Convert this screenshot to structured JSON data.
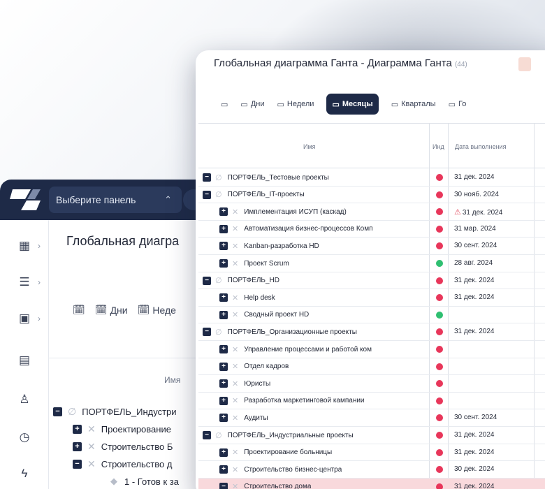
{
  "back_window": {
    "panel_select": "Выберите панель",
    "title": "Глобальная диагра",
    "tabs": [
      "Дни",
      "Неде"
    ],
    "column_name": "Имя",
    "rows": [
      {
        "label": "ПОРТФЕЛЬ_Индустри",
        "level": 0
      },
      {
        "label": "Проектирование",
        "level": 1
      },
      {
        "label": "Строительство Б",
        "level": 1
      },
      {
        "label": "Строительство д",
        "level": 1
      },
      {
        "label": "1 - Готов к за",
        "level": 2
      }
    ]
  },
  "front_window": {
    "title": "Глобальная диаграмма Ганта - Диаграмма Ганта",
    "count": "(44)",
    "tabs": [
      {
        "label": "",
        "icon": "calendar-icon"
      },
      {
        "label": "Дни",
        "icon": "calendar-icon"
      },
      {
        "label": "Недели",
        "icon": "calendar-icon"
      },
      {
        "label": "Месяцы",
        "icon": "calendar-icon",
        "active": true
      },
      {
        "label": "Кварталы",
        "icon": "calendar-icon"
      },
      {
        "label": "Го",
        "icon": "calendar-icon"
      }
    ],
    "columns": {
      "name": "Имя",
      "indicator": "Инд",
      "date": "Дата выполнения"
    },
    "rows": [
      {
        "name": "ПОРТФЕЛЬ_Тестовые проекты",
        "level": 0,
        "status": "red",
        "date": "31 дек. 2024"
      },
      {
        "name": "ПОРТФЕЛЬ_IT-проекты",
        "level": 0,
        "status": "red",
        "date": "30 нояб. 2024"
      },
      {
        "name": "Имплементация ИСУП (каскад)",
        "level": 1,
        "status": "red",
        "date": "31 дек. 2024",
        "warning": true
      },
      {
        "name": "Автоматизация бизнес-процессов Комп",
        "level": 1,
        "status": "red",
        "date": "31 мар. 2024"
      },
      {
        "name": "Kanban-разработка HD",
        "level": 1,
        "status": "red",
        "date": "30 сент. 2024"
      },
      {
        "name": "Проект Scrum",
        "level": 1,
        "status": "green",
        "date": "28 авг. 2024"
      },
      {
        "name": "ПОРТФЕЛЬ_HD",
        "level": 0,
        "status": "red",
        "date": "31 дек. 2024"
      },
      {
        "name": "Help desk",
        "level": 1,
        "status": "red",
        "date": "31 дек. 2024"
      },
      {
        "name": "Сводный проект HD",
        "level": 1,
        "status": "green",
        "date": ""
      },
      {
        "name": "ПОРТФЕЛЬ_Организационные проекты",
        "level": 0,
        "status": "red",
        "date": "31 дек. 2024"
      },
      {
        "name": "Управление процессами и работой ком",
        "level": 1,
        "status": "red",
        "date": ""
      },
      {
        "name": "Отдел кадров",
        "level": 1,
        "status": "red",
        "date": ""
      },
      {
        "name": "Юристы",
        "level": 1,
        "status": "red",
        "date": ""
      },
      {
        "name": "Разработка маркетинговой кампании",
        "level": 1,
        "status": "red",
        "date": ""
      },
      {
        "name": "Аудиты",
        "level": 1,
        "status": "red",
        "date": "30 сент. 2024"
      },
      {
        "name": "ПОРТФЕЛЬ_Индустриальные проекты",
        "level": 0,
        "status": "red",
        "date": "31 дек. 2024"
      },
      {
        "name": "Проектирование больницы",
        "level": 1,
        "status": "red",
        "date": "31 дек. 2024"
      },
      {
        "name": "Строительство бизнес-центра",
        "level": 1,
        "status": "red",
        "date": "30 дек. 2024"
      },
      {
        "name": "Строительство дома",
        "level": 1,
        "status": "red",
        "date": "31 дек. 2024",
        "highlight": true
      }
    ]
  },
  "colors": {
    "navy": "#1e2a47",
    "red": "#e8365a",
    "green": "#2fbf71",
    "highlight": "#f9d9dc"
  }
}
